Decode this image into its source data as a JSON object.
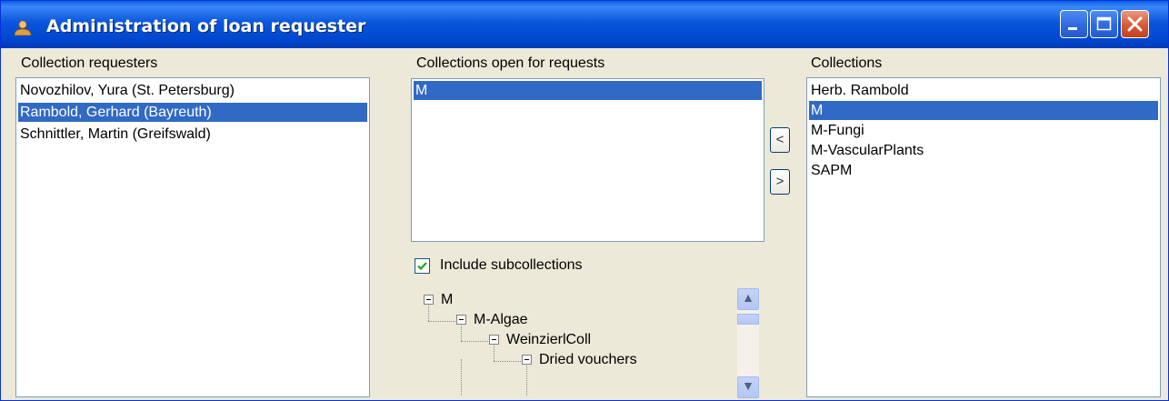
{
  "window": {
    "title": "Administration of loan requester",
    "controls": {
      "minimize": "minimize",
      "maximize": "maximize",
      "close": "close"
    }
  },
  "requesters": {
    "label": "Collection requesters",
    "items": [
      {
        "label": "Novozhilov, Yura (St. Petersburg)",
        "selected": false
      },
      {
        "label": "Rambold, Gerhard (Bayreuth)",
        "selected": true
      },
      {
        "label": "Schnittler, Martin (Greifswald)",
        "selected": false
      }
    ]
  },
  "open_collections": {
    "label": "Collections open for requests",
    "items": [
      {
        "label": "M",
        "selected": true
      }
    ]
  },
  "transfer": {
    "add_glyph": "<",
    "remove_glyph": ">"
  },
  "include_subcollections": {
    "label": "Include subcollections",
    "checked": true
  },
  "subcollection_tree": [
    {
      "label": "M",
      "level": 0,
      "expanded": true
    },
    {
      "label": "M-Algae",
      "level": 1,
      "expanded": true
    },
    {
      "label": "WeinzierlColl",
      "level": 2,
      "expanded": true
    },
    {
      "label": "Dried vouchers",
      "level": 3,
      "expanded": true
    }
  ],
  "collections": {
    "label": "Collections",
    "items": [
      {
        "label": "Herb. Rambold",
        "selected": false
      },
      {
        "label": "M",
        "selected": true
      },
      {
        "label": "M-Fungi",
        "selected": false
      },
      {
        "label": "M-VascularPlants",
        "selected": false
      },
      {
        "label": "SAPM",
        "selected": false
      }
    ]
  },
  "colors": {
    "selection": "#316ac5",
    "titlebar": "#0a56dc",
    "panel": "#ece9d8",
    "checkmark": "#21a121"
  },
  "icons": {
    "window": "user-icon",
    "checkbox": "checkmark-icon",
    "tree_expand": "minus-box-icon",
    "scroll_up": "chevron-up-icon",
    "scroll_down": "chevron-down-icon"
  }
}
